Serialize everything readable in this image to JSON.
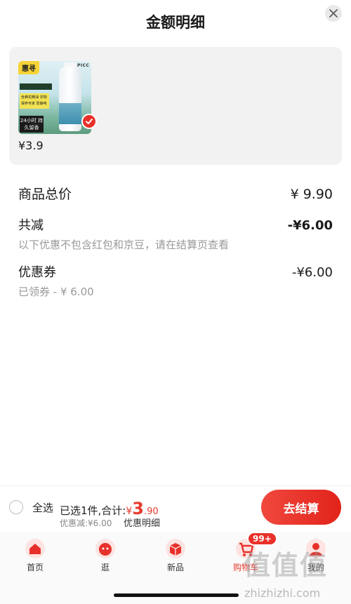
{
  "sheet": {
    "title": "金额明细",
    "close_icon": "close-icon"
  },
  "product": {
    "thumb_badge": "惠寻",
    "thumb_brand": "PICC",
    "thumb_tags": "含蜂花精油 衣物保养专家 防静电",
    "thumb_bottom": "24小时 持久留香",
    "price": "¥3.9",
    "selected_icon": "checkmark-icon"
  },
  "breakdown": {
    "total_label": "商品总价",
    "total_value": "¥ 9.90",
    "reduce_label": "共减",
    "reduce_value": "-¥6.00",
    "reduce_note": "以下优惠不包含红包和京豆，请在结算页查看",
    "coupon_label": "优惠券",
    "coupon_value": "-¥6.00",
    "coupon_note": "已领券 - ¥ 6.00"
  },
  "bottom_bar": {
    "select_all": "全选",
    "summary_text": "已选1件,合计:",
    "total_symbol": "¥",
    "total_int": "3",
    "total_dec": ".90",
    "discount": "优惠减:¥6.00",
    "detail_link": "优惠明细",
    "checkout": "去结算"
  },
  "tabbar": {
    "tabs": [
      {
        "label": "首页",
        "icon": "home-icon"
      },
      {
        "label": "逛",
        "icon": "browse-icon"
      },
      {
        "label": "新品",
        "icon": "new-product-icon"
      },
      {
        "label": "购物车",
        "icon": "cart-icon"
      },
      {
        "label": "我的",
        "icon": "profile-icon"
      }
    ],
    "cart_badge": "99+"
  },
  "watermark": {
    "text": "值值值",
    "url": "zhizhizhi.com"
  },
  "colors": {
    "accent": "#e63a2e",
    "card_bg": "#f2f2f2"
  }
}
